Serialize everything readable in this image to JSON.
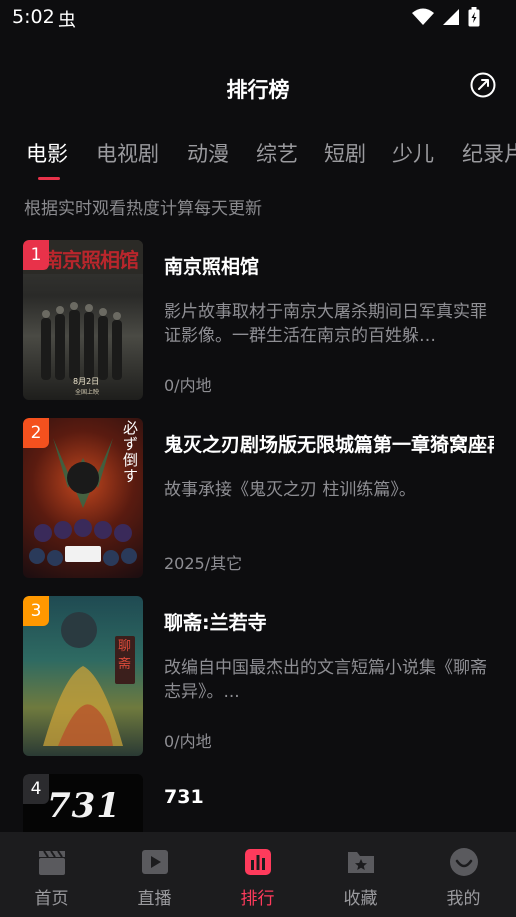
{
  "status_bar": {
    "time": "5:02",
    "app_glyph": "虫"
  },
  "header": {
    "title": "排行榜",
    "share_icon": "share-icon"
  },
  "tabs": [
    {
      "label": "电影",
      "active": true
    },
    {
      "label": "电视剧",
      "active": false
    },
    {
      "label": "动漫",
      "active": false
    },
    {
      "label": "综艺",
      "active": false
    },
    {
      "label": "短剧",
      "active": false
    },
    {
      "label": "少儿",
      "active": false
    },
    {
      "label": "纪录片",
      "active": false
    }
  ],
  "subtitle": "根据实时观看热度计算每天更新",
  "items": [
    {
      "rank": "1",
      "title": "南京照相馆",
      "desc": "影片故事取材于南京大屠杀期间日军真实罪证影像。一群生活在南京的百姓躲…",
      "meta": "0/内地",
      "rank_color": "#e8324a",
      "poster_text": "南京照相馆",
      "poster_date": "8月2日",
      "poster_sub": "全国上映"
    },
    {
      "rank": "2",
      "title": "鬼灭之刃剧场版无限城篇第一章猗窝座再袭",
      "desc": "故事承接《鬼灭之刃 柱训练篇》。",
      "meta": "2025/其它",
      "rank_color": "#f4511e",
      "poster_text": "必ず倒す"
    },
    {
      "rank": "3",
      "title": "聊斋:兰若寺",
      "desc": "改编自中国最杰出的文言短篇小说集《聊斋志异》。...",
      "meta": "0/内地",
      "rank_color": "#ff9800",
      "poster_text": "聊斋"
    },
    {
      "rank": "4",
      "title": "731",
      "desc": "",
      "meta": "",
      "rank_color": "#2b2b2e",
      "poster_text": "731"
    }
  ],
  "bottom_nav": [
    {
      "label": "首页",
      "icon": "clapperboard-icon",
      "active": false
    },
    {
      "label": "直播",
      "icon": "play-icon",
      "active": false
    },
    {
      "label": "排行",
      "icon": "ranking-icon",
      "active": true
    },
    {
      "label": "收藏",
      "icon": "folder-star-icon",
      "active": false
    },
    {
      "label": "我的",
      "icon": "profile-icon",
      "active": false
    }
  ],
  "colors": {
    "accent": "#ff3b5c",
    "background": "#0d0d0f",
    "nav_bg": "#1c1c1e"
  }
}
